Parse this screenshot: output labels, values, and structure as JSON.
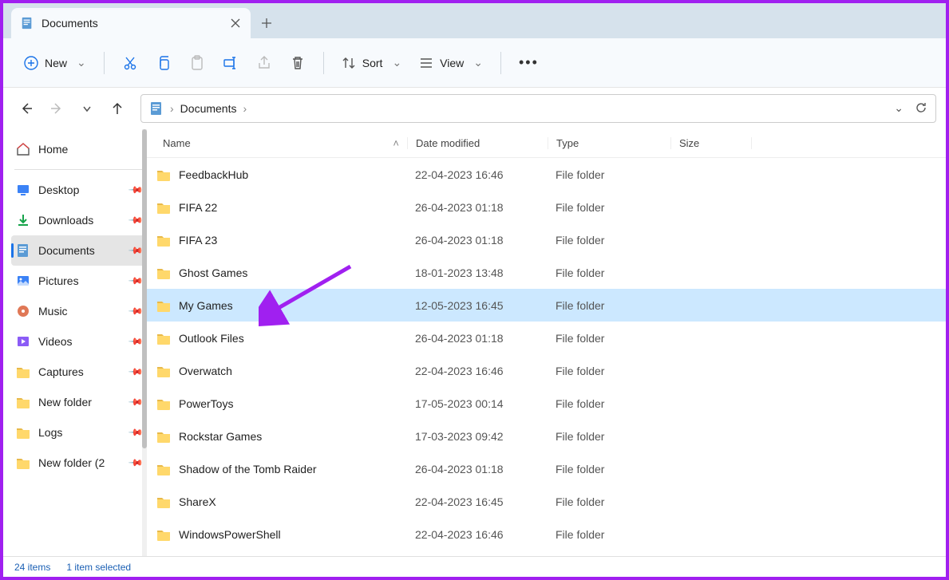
{
  "tab": {
    "title": "Documents"
  },
  "toolbar": {
    "new": "New",
    "sort": "Sort",
    "view": "View"
  },
  "breadcrumb": {
    "location": "Documents"
  },
  "sidebar": {
    "home": "Home",
    "items": [
      {
        "label": "Desktop",
        "icon": "desktop"
      },
      {
        "label": "Downloads",
        "icon": "download"
      },
      {
        "label": "Documents",
        "icon": "document",
        "active": true
      },
      {
        "label": "Pictures",
        "icon": "pictures"
      },
      {
        "label": "Music",
        "icon": "music"
      },
      {
        "label": "Videos",
        "icon": "videos"
      },
      {
        "label": "Captures",
        "icon": "folder"
      },
      {
        "label": "New folder",
        "icon": "folder"
      },
      {
        "label": "Logs",
        "icon": "folder"
      },
      {
        "label": "New folder (2",
        "icon": "folder"
      }
    ]
  },
  "columns": {
    "name": "Name",
    "date": "Date modified",
    "type": "Type",
    "size": "Size"
  },
  "rows": [
    {
      "name": "FeedbackHub",
      "date": "22-04-2023 16:46",
      "type": "File folder"
    },
    {
      "name": "FIFA 22",
      "date": "26-04-2023 01:18",
      "type": "File folder"
    },
    {
      "name": "FIFA 23",
      "date": "26-04-2023 01:18",
      "type": "File folder"
    },
    {
      "name": "Ghost Games",
      "date": "18-01-2023 13:48",
      "type": "File folder"
    },
    {
      "name": "My Games",
      "date": "12-05-2023 16:45",
      "type": "File folder",
      "selected": true
    },
    {
      "name": "Outlook Files",
      "date": "26-04-2023 01:18",
      "type": "File folder"
    },
    {
      "name": "Overwatch",
      "date": "22-04-2023 16:46",
      "type": "File folder"
    },
    {
      "name": "PowerToys",
      "date": "17-05-2023 00:14",
      "type": "File folder"
    },
    {
      "name": "Rockstar Games",
      "date": "17-03-2023 09:42",
      "type": "File folder"
    },
    {
      "name": "Shadow of the Tomb Raider",
      "date": "26-04-2023 01:18",
      "type": "File folder"
    },
    {
      "name": "ShareX",
      "date": "22-04-2023 16:45",
      "type": "File folder"
    },
    {
      "name": "WindowsPowerShell",
      "date": "22-04-2023 16:46",
      "type": "File folder"
    }
  ],
  "status": {
    "count": "24 items",
    "selected": "1 item selected"
  }
}
